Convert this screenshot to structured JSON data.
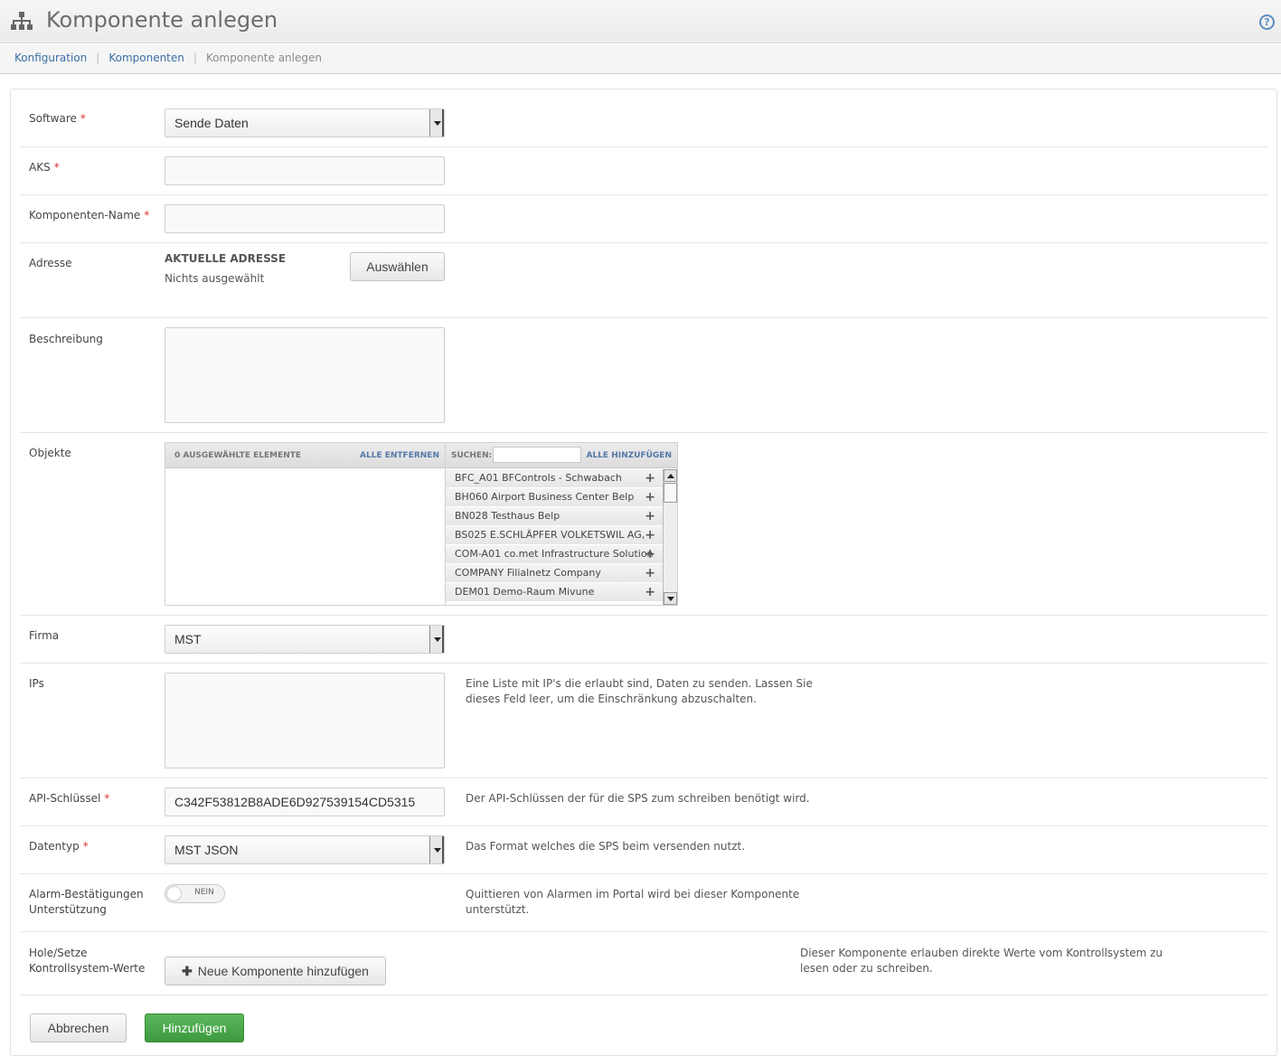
{
  "header": {
    "title": "Komponente anlegen",
    "help_icon": "?"
  },
  "breadcrumb": {
    "items": [
      "Konfiguration",
      "Komponenten"
    ],
    "current": "Komponente anlegen",
    "separator": "|"
  },
  "form": {
    "required_mark": "*",
    "software": {
      "label": "Software",
      "value": "Sende Daten"
    },
    "aks": {
      "label": "AKS",
      "value": ""
    },
    "component_name": {
      "label": "Komponenten-Name",
      "value": ""
    },
    "address": {
      "label": "Adresse",
      "current_title": "AKTUELLE ADRESSE",
      "current_value": "Nichts ausgewählt",
      "select_button": "Auswählen"
    },
    "description": {
      "label": "Beschreibung"
    },
    "objects": {
      "label": "Objekte",
      "selected_title": "0 AUSGEWÄHLTE ELEMENTE",
      "remove_all": "ALLE ENTFERNEN",
      "search_label": "SUCHEN:",
      "add_all": "ALLE HINZUFÜGEN",
      "plus": "+",
      "items": [
        "BFC_A01 BFControls - Schwabach",
        "BH060 Airport Business Center Belp",
        "BN028 Testhaus Belp",
        "BS025 E.SCHLÄPFER VOLKETSWIL AG,",
        "COM-A01 co.met Infrastructure Solution",
        "COMPANY Filialnetz Company",
        "DEM01 Demo-Raum Mivune"
      ]
    },
    "company": {
      "label": "Firma",
      "value": "MST"
    },
    "ips": {
      "label": "IPs",
      "help_line1": "Eine Liste mit IP's die erlaubt sind, Daten zu senden. Lassen Sie",
      "help_line2": "dieses Feld leer, um die Einschränkung abzuschalten."
    },
    "api_key": {
      "label": "API-Schlüssel",
      "value": "C342F53812B8ADE6D927539154CD5315",
      "help": "Der API-Schlüssen der für die SPS zum schreiben benötigt wird."
    },
    "data_type": {
      "label": "Datentyp",
      "value": "MST JSON",
      "help": "Das Format welches die SPS beim versenden nutzt."
    },
    "alarm": {
      "label_line1": "Alarm-Bestätigungen",
      "label_line2": "Unterstützung",
      "toggle_text": "NEIN",
      "help_line1": "Quittieren von Alarmen im Portal wird bei dieser Komponente",
      "help_line2": "unterstützt."
    },
    "control_values": {
      "label_line1": "Hole/Setze",
      "label_line2": "Kontrollsystem-Werte",
      "button": "Neue Komponente hinzufügen",
      "help_line1": "Dieser Komponente erlauben direkte Werte vom Kontrollsystem zu",
      "help_line2": "lesen oder zu schreiben."
    }
  },
  "actions": {
    "cancel": "Abbrechen",
    "submit": "Hinzufügen"
  },
  "colors": {
    "link": "#3a6ea5",
    "required": "#d9322e",
    "primary": "#4aa84a"
  }
}
